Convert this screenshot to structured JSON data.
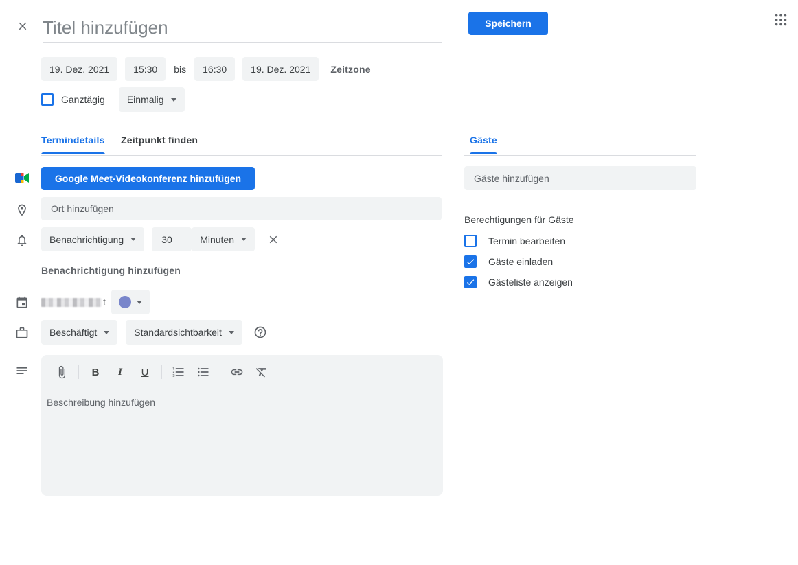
{
  "header": {
    "title_placeholder": "Titel hinzufügen",
    "save_label": "Speichern"
  },
  "datetime": {
    "start_date": "19. Dez. 2021",
    "start_time": "15:30",
    "separator": "bis",
    "end_time": "16:30",
    "end_date": "19. Dez. 2021",
    "timezone_label": "Zeitzone",
    "all_day_label": "Ganztägig",
    "recurrence_value": "Einmalig"
  },
  "tabs": {
    "left": [
      {
        "label": "Termindetails",
        "active": true
      },
      {
        "label": "Zeitpunkt finden",
        "active": false
      }
    ],
    "right": [
      {
        "label": "Gäste",
        "active": true
      }
    ]
  },
  "details": {
    "meet_button_label": "Google Meet-Videokonferenz hinzufügen",
    "location_placeholder": "Ort hinzufügen",
    "notification": {
      "type_value": "Benachrichtigung",
      "amount_value": "30",
      "unit_value": "Minuten"
    },
    "add_notification_label": "Benachrichtigung hinzufügen",
    "calendar_owner_redacted": true,
    "calendar_owner_suffix": "t",
    "calendar_color": "#7986cb",
    "busy_value": "Beschäftigt",
    "visibility_value": "Standardsichtbarkeit",
    "toolbar": {
      "bold": "B",
      "italic": "I",
      "underline": "U"
    },
    "description_placeholder": "Beschreibung hinzufügen"
  },
  "guests": {
    "input_placeholder": "Gäste hinzufügen",
    "permissions_title": "Berechtigungen für Gäste",
    "permissions": [
      {
        "label": "Termin bearbeiten",
        "checked": false
      },
      {
        "label": "Gäste einladen",
        "checked": true
      },
      {
        "label": "Gästeliste anzeigen",
        "checked": true
      }
    ]
  },
  "colors": {
    "accent_blue": "#1a73e8",
    "chip_background": "#f1f3f4",
    "text_dark": "#3c4043",
    "text_gray": "#5f6368",
    "divider": "#dadce0",
    "calendar_dot": "#7986cb"
  }
}
